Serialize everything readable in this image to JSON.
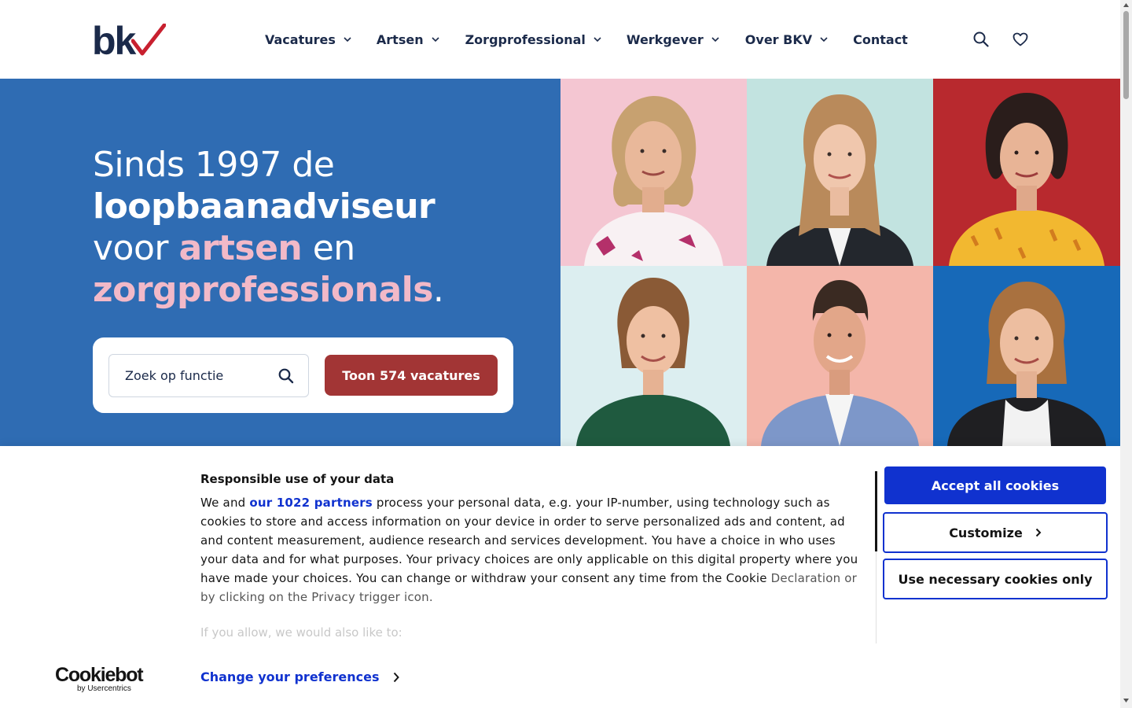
{
  "brand": {
    "logo_text": "bk",
    "logo_check_color": "#c8202f",
    "primary_color": "#2f6cb3",
    "accent_pink": "#f2b9c8",
    "cta_color": "#a23535",
    "cookie_blue": "#1032cf"
  },
  "nav": {
    "items": [
      {
        "label": "Vacatures",
        "has_dropdown": true
      },
      {
        "label": "Artsen",
        "has_dropdown": true
      },
      {
        "label": "Zorgprofessional",
        "has_dropdown": true
      },
      {
        "label": "Werkgever",
        "has_dropdown": true
      },
      {
        "label": "Over BKV",
        "has_dropdown": true
      },
      {
        "label": "Contact",
        "has_dropdown": false
      }
    ],
    "icons": [
      "search-icon",
      "heart-icon"
    ]
  },
  "hero": {
    "line1": "Sinds 1997 de",
    "line2": "loopbaanadviseur",
    "line3_a": "voor ",
    "line3_b": "artsen",
    "line3_c": " en",
    "line4_a": "zorgprofessionals",
    "line4_b": ".",
    "search_placeholder": "Zoek op functie",
    "cta_label": "Toon 574 vacatures"
  },
  "photos": [
    {
      "bg": "#f4c6d2"
    },
    {
      "bg": "#c2e3e0"
    },
    {
      "bg": "#b8292e"
    },
    {
      "bg": "#dceef0"
    },
    {
      "bg": "#f4b6aa"
    },
    {
      "bg": "#1769b8"
    }
  ],
  "cookie": {
    "title": "Responsible use of your data",
    "body_prefix": "We and ",
    "partners_link": "our 1022 partners",
    "body_main": " process your personal data, e.g. your IP-number, using technology such as cookies to store and access information on your device in order to serve personalized ads and content, ad and content measurement, audience research and services development. You have a choice in who uses your data and for what purposes. Your privacy choices are only applicable on this digital property where you have made your choices. You can change or withdraw your consent any time from the Cookie ",
    "body_faded": "Declaration or by clicking on the Privacy trigger icon.",
    "more_text": "If you allow, we would also like to:",
    "accept_label": "Accept all cookies",
    "customize_label": "Customize",
    "necessary_label": "Use necessary cookies only",
    "change_prefs_label": "Change your preferences",
    "cookiebot_name": "Cookiebot",
    "cookiebot_sub": "by Usercentrics"
  }
}
